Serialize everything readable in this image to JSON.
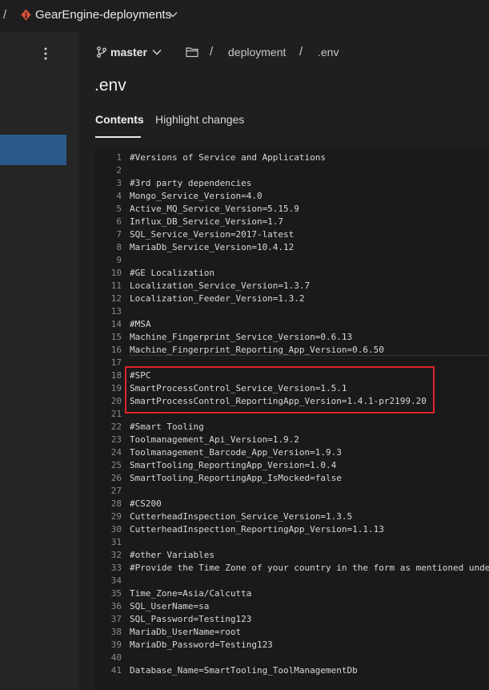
{
  "topbar": {
    "separator": "/",
    "repo_name": "GearEngine-deployments",
    "repo_icon": "git-repo-icon",
    "chevron_icon": "chevron-down-icon",
    "accent_color": "#e0523a"
  },
  "sidebar": {
    "menu_icon": "kebab-menu-icon",
    "selected_color": "#2b5a8a"
  },
  "breadcrumb": {
    "branch": "master",
    "branch_icon": "git-branch-icon",
    "folder_icon": "folder-icon",
    "separator": "/",
    "path": [
      "deployment",
      ".env"
    ]
  },
  "file": {
    "title": ".env"
  },
  "tabs": [
    {
      "label": "Contents",
      "selected": true
    },
    {
      "label": "Highlight changes",
      "selected": false
    }
  ],
  "code_lines": [
    {
      "n": "1",
      "text": "#Versions of Service and Applications"
    },
    {
      "n": "2",
      "text": ""
    },
    {
      "n": "3",
      "text": "#3rd party dependencies"
    },
    {
      "n": "4",
      "text": "Mongo_Service_Version=4.0"
    },
    {
      "n": "5",
      "text": "Active_MQ_Service_Version=5.15.9"
    },
    {
      "n": "6",
      "text": "Influx_DB_Service_Version=1.7"
    },
    {
      "n": "7",
      "text": "SQL_Service_Version=2017-latest"
    },
    {
      "n": "8",
      "text": "MariaDb_Service_Version=10.4.12"
    },
    {
      "n": "9",
      "text": ""
    },
    {
      "n": "10",
      "text": "#GE Localization"
    },
    {
      "n": "11",
      "text": "Localization_Service_Version=1.3.7"
    },
    {
      "n": "12",
      "text": "Localization_Feeder_Version=1.3.2"
    },
    {
      "n": "13",
      "text": ""
    },
    {
      "n": "14",
      "text": "#MSA"
    },
    {
      "n": "15",
      "text": "Machine_Fingerprint_Service_Version=0.6.13"
    },
    {
      "n": "16",
      "text": "Machine_Fingerprint_Reporting_App_Version=0.6.50"
    },
    {
      "n": "17",
      "text": ""
    },
    {
      "n": "18",
      "text": "#SPC"
    },
    {
      "n": "19",
      "text": "SmartProcessControl_Service_Version=1.5.1"
    },
    {
      "n": "20",
      "text": "SmartProcessControl_ReportingApp_Version=1.4.1-pr2199.20"
    },
    {
      "n": "21",
      "text": ""
    },
    {
      "n": "22",
      "text": "#Smart Tooling"
    },
    {
      "n": "23",
      "text": "Toolmanagement_Api_Version=1.9.2"
    },
    {
      "n": "24",
      "text": "Toolmanagement_Barcode_App_Version=1.9.3"
    },
    {
      "n": "25",
      "text": "SmartTooling_ReportingApp_Version=1.0.4"
    },
    {
      "n": "26",
      "text": "SmartTooling_ReportingApp_IsMocked=false"
    },
    {
      "n": "27",
      "text": ""
    },
    {
      "n": "28",
      "text": "#CS200"
    },
    {
      "n": "29",
      "text": "CutterheadInspection_Service_Version=1.3.5"
    },
    {
      "n": "30",
      "text": "CutterheadInspection_ReportingApp_Version=1.1.13"
    },
    {
      "n": "31",
      "text": ""
    },
    {
      "n": "32",
      "text": "#other Variables"
    },
    {
      "n": "33",
      "text": "#Provide the Time Zone of your country in the form as mentioned unde"
    },
    {
      "n": "34",
      "text": ""
    },
    {
      "n": "35",
      "text": "Time_Zone=Asia/Calcutta"
    },
    {
      "n": "36",
      "text": "SQL_UserName=sa"
    },
    {
      "n": "37",
      "text": "SQL_Password=Testing123"
    },
    {
      "n": "38",
      "text": "MariaDb_UserName=root"
    },
    {
      "n": "39",
      "text": "MariaDb_Password=Testing123"
    },
    {
      "n": "40",
      "text": ""
    },
    {
      "n": "41",
      "text": "Database_Name=SmartTooling_ToolManagementDb"
    }
  ],
  "annotation": {
    "highlight_color": "#e0242c"
  }
}
